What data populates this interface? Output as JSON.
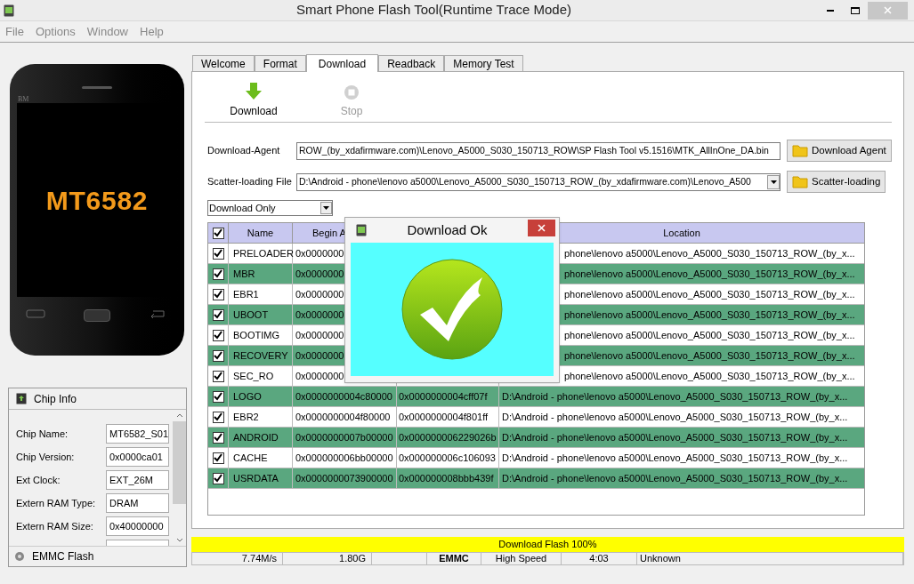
{
  "window": {
    "title": "Smart Phone Flash Tool(Runtime Trace Mode)"
  },
  "menu": [
    "File",
    "Options",
    "Window",
    "Help"
  ],
  "phone": {
    "brand_mark": "BM",
    "model": "MT6582"
  },
  "chip_info": {
    "title": "Chip Info",
    "fields": [
      {
        "label": "Chip Name:",
        "value": "MT6582_S01"
      },
      {
        "label": "Chip Version:",
        "value": "0x0000ca01"
      },
      {
        "label": "Ext Clock:",
        "value": "EXT_26M"
      },
      {
        "label": "Extern RAM Type:",
        "value": "DRAM"
      },
      {
        "label": "Extern RAM Size:",
        "value": "0x40000000"
      }
    ],
    "footer": "EMMC Flash"
  },
  "tabs": [
    {
      "label": "Welcome",
      "selected": false
    },
    {
      "label": "Format",
      "selected": false
    },
    {
      "label": "Download",
      "selected": true
    },
    {
      "label": "Readback",
      "selected": false
    },
    {
      "label": "Memory Test",
      "selected": false
    }
  ],
  "toolbar": [
    {
      "kind": "download",
      "label": "Download",
      "disabled": false
    },
    {
      "kind": "stop",
      "label": "Stop",
      "disabled": true
    }
  ],
  "download_agent": {
    "label": "Download-Agent",
    "value": "ROW_(by_xdafirmware.com)\\Lenovo_A5000_S030_150713_ROW\\SP Flash Tool v5.1516\\MTK_AllInOne_DA.bin",
    "button": "Download Agent"
  },
  "scatter": {
    "label": "Scatter-loading File",
    "value": "D:\\Android - phone\\lenovo a5000\\Lenovo_A5000_S030_150713_ROW_(by_xdafirmware.com)\\Lenovo_A500",
    "button": "Scatter-loading"
  },
  "mode_select": {
    "value": "Download Only"
  },
  "table": {
    "all_checked": true,
    "header": {
      "name": "Name",
      "begin_address": "Begin A",
      "location": "Location"
    },
    "rows": [
      {
        "checked": true,
        "name": "PRELOADER",
        "begin_address": "0x0000000",
        "location": "phone\\lenovo a5000\\Lenovo_A5000_S030_150713_ROW_(by_x..."
      },
      {
        "checked": true,
        "name": "MBR",
        "begin_address": "0x0000000",
        "location": "phone\\lenovo a5000\\Lenovo_A5000_S030_150713_ROW_(by_x..."
      },
      {
        "checked": true,
        "name": "EBR1",
        "begin_address": "0x0000000",
        "location": "phone\\lenovo a5000\\Lenovo_A5000_S030_150713_ROW_(by_x..."
      },
      {
        "checked": true,
        "name": "UBOOT",
        "begin_address": "0x0000000",
        "location": "phone\\lenovo a5000\\Lenovo_A5000_S030_150713_ROW_(by_x..."
      },
      {
        "checked": true,
        "name": "BOOTIMG",
        "begin_address": "0x0000000",
        "location": "phone\\lenovo a5000\\Lenovo_A5000_S030_150713_ROW_(by_x..."
      },
      {
        "checked": true,
        "name": "RECOVERY",
        "begin_address": "0x0000000",
        "location": "phone\\lenovo a5000\\Lenovo_A5000_S030_150713_ROW_(by_x..."
      },
      {
        "checked": true,
        "name": "SEC_RO",
        "begin_address": "0x0000000",
        "location": "phone\\lenovo a5000\\Lenovo_A5000_S030_150713_ROW_(by_x..."
      },
      {
        "checked": true,
        "name": "LOGO",
        "begin_address": "0x0000000004c80000",
        "end_address": "0x0000000004cff07f",
        "location": "D:\\Android - phone\\lenovo a5000\\Lenovo_A5000_S030_150713_ROW_(by_x..."
      },
      {
        "checked": true,
        "name": "EBR2",
        "begin_address": "0x0000000004f80000",
        "end_address": "0x0000000004f801ff",
        "location": "D:\\Android - phone\\lenovo a5000\\Lenovo_A5000_S030_150713_ROW_(by_x..."
      },
      {
        "checked": true,
        "name": "ANDROID",
        "begin_address": "0x0000000007b00000",
        "end_address": "0x000000006229026b",
        "location": "D:\\Android - phone\\lenovo a5000\\Lenovo_A5000_S030_150713_ROW_(by_x..."
      },
      {
        "checked": true,
        "name": "CACHE",
        "begin_address": "0x000000006bb00000",
        "end_address": "0x000000006c106093",
        "location": "D:\\Android - phone\\lenovo a5000\\Lenovo_A5000_S030_150713_ROW_(by_x..."
      },
      {
        "checked": true,
        "name": "USRDATA",
        "begin_address": "0x0000000073900000",
        "end_address": "0x000000008bbb439f",
        "location": "D:\\Android - phone\\lenovo a5000\\Lenovo_A5000_S030_150713_ROW_(by_x..."
      }
    ]
  },
  "dialog": {
    "title": "Download Ok"
  },
  "progress": {
    "label": "Download Flash 100%",
    "level": 1
  },
  "status_bar": [
    {
      "text": "7.74M/s",
      "kind": "right"
    },
    {
      "text": "1.80G",
      "kind": "right"
    },
    {
      "text": "EMMC",
      "kind": "bold"
    },
    {
      "text": "High Speed",
      "kind": "center"
    },
    {
      "text": "4:03",
      "kind": "center"
    },
    {
      "text": "Unknown",
      "kind": "left"
    }
  ]
}
